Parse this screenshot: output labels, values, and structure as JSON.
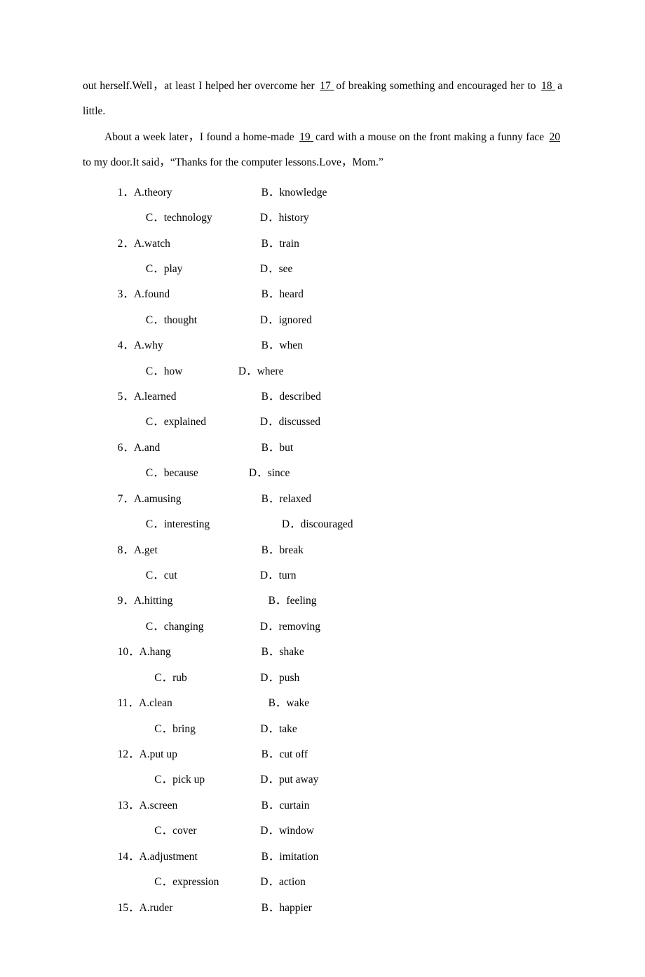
{
  "passage": {
    "line1a": "out herself.Well，at least I helped her overcome her ",
    "blank17": "  17  ",
    "line1b": " of breaking something and encouraged her to ",
    "blank18": "  18  ",
    "line1c": " a little.",
    "line2a": "About a week later，I found a home-made ",
    "blank19": "  19  ",
    "line2b": " card with a mouse on the front making a funny face ",
    "blank20": "  20  ",
    "line2c": " to my door.It said，“Thanks for the computer lessons.Love，Mom.”"
  },
  "questions": [
    {
      "n": "1",
      "a": "A.theory",
      "b": "B．knowledge",
      "c": "C．technology",
      "d": "D．history"
    },
    {
      "n": "2",
      "a": "A.watch",
      "b": "B．train",
      "c": "C．play",
      "d": "D．see"
    },
    {
      "n": "3",
      "a": "A.found",
      "b": "B．heard",
      "c": "C．thought",
      "d": "D．ignored"
    },
    {
      "n": "4",
      "a": "A.why",
      "b": "B．when",
      "c": "C．how",
      "d": "D．where"
    },
    {
      "n": "5",
      "a": "A.learned",
      "b": "B．described",
      "c": "C．explained",
      "d": "D．discussed"
    },
    {
      "n": "6",
      "a": "A.and",
      "b": "B．but",
      "c": "C．because",
      "d": "D．since"
    },
    {
      "n": "7",
      "a": "A.amusing",
      "b": "B．relaxed",
      "c": "C．interesting",
      "d": "D．discouraged"
    },
    {
      "n": "8",
      "a": "A.get",
      "b": "B．break",
      "c": "C．cut",
      "d": "D．turn"
    },
    {
      "n": "9",
      "a": "A.hitting",
      "b": "B．feeling",
      "c": "C．changing",
      "d": "D．removing"
    },
    {
      "n": "10",
      "a": "A.hang",
      "b": "B．shake",
      "c": "C．rub",
      "d": "D．push"
    },
    {
      "n": "11",
      "a": "A.clean",
      "b": "B．wake",
      "c": "C．bring",
      "d": "D．take"
    },
    {
      "n": "12",
      "a": "A.put up",
      "b": "B．cut off",
      "c": "C．pick up",
      "d": "D．put away"
    },
    {
      "n": "13",
      "a": "A.screen",
      "b": "B．curtain",
      "c": "C．cover",
      "d": "D．window"
    },
    {
      "n": "14",
      "a": "A.adjustment",
      "b": "B．imitation",
      "c": "C．expression",
      "d": "D．action"
    },
    {
      "n": "15",
      "a": "A.ruder",
      "b": "B．happier"
    }
  ]
}
